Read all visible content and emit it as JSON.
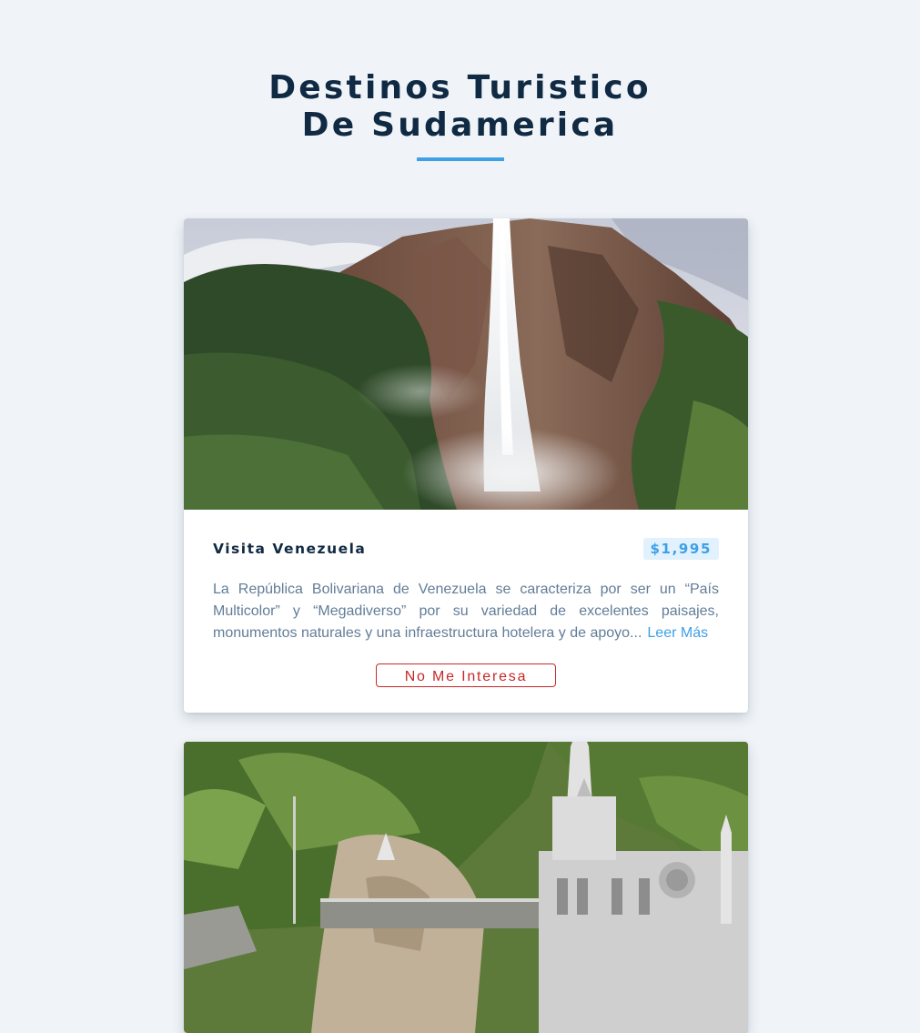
{
  "page": {
    "title": "Destinos Turistico De Sudamerica",
    "accent_color": "#3ea0e6",
    "background_color": "#f0f4f8"
  },
  "cards": [
    {
      "image_icon": "waterfall-photo",
      "title": "Visita Venezuela",
      "price": "$1,995",
      "description": "La República Bolivariana de Venezuela se caracteriza por ser un “País Multicolor” y “Megadiverso” por su variedad de excelentes paisajes, monumentos naturales y una infraestructura hotelera y de apoyo...",
      "read_more_label": "Leer Más",
      "dismiss_label": "No Me Interesa",
      "dismiss_color": "#c62828"
    },
    {
      "image_icon": "cathedral-photo"
    }
  ]
}
